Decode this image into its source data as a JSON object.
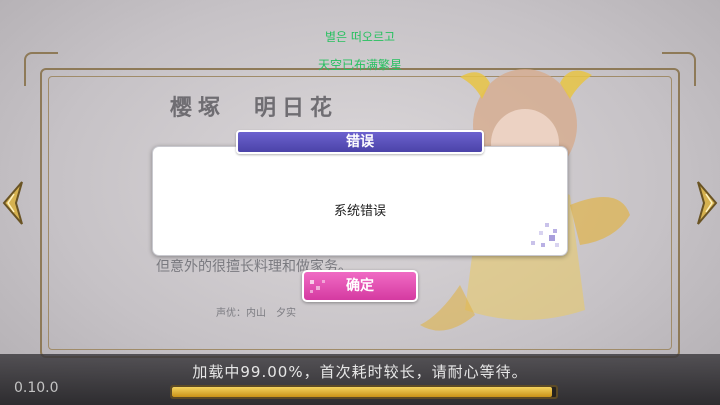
{
  "header": {
    "korean_text": "별은 떠오르고",
    "chinese_text": "天空已布满繁星"
  },
  "character": {
    "name": "樱塚　明日花",
    "description_visible": "但意外的很擅长料理和做家务。",
    "cv_label": "声优：内山　夕实"
  },
  "dialog": {
    "title": "错误",
    "message": "系统错误",
    "ok_label": "确定"
  },
  "footer": {
    "version": "0.10.0",
    "loading_text": "加载中99.00%，首次耗时较长，请耐心等待。",
    "progress_percent": 99
  },
  "colors": {
    "dialog_title_bg": "#5a52bd",
    "ok_button_bg": "#e04bb0",
    "header_text": "#28c060",
    "progress_fill": "#e0b232"
  },
  "icons": {
    "left_arrow": "ornament-left-arrow-icon",
    "right_arrow": "ornament-right-arrow-icon",
    "sparkle": "pixel-sparkle-icon"
  }
}
